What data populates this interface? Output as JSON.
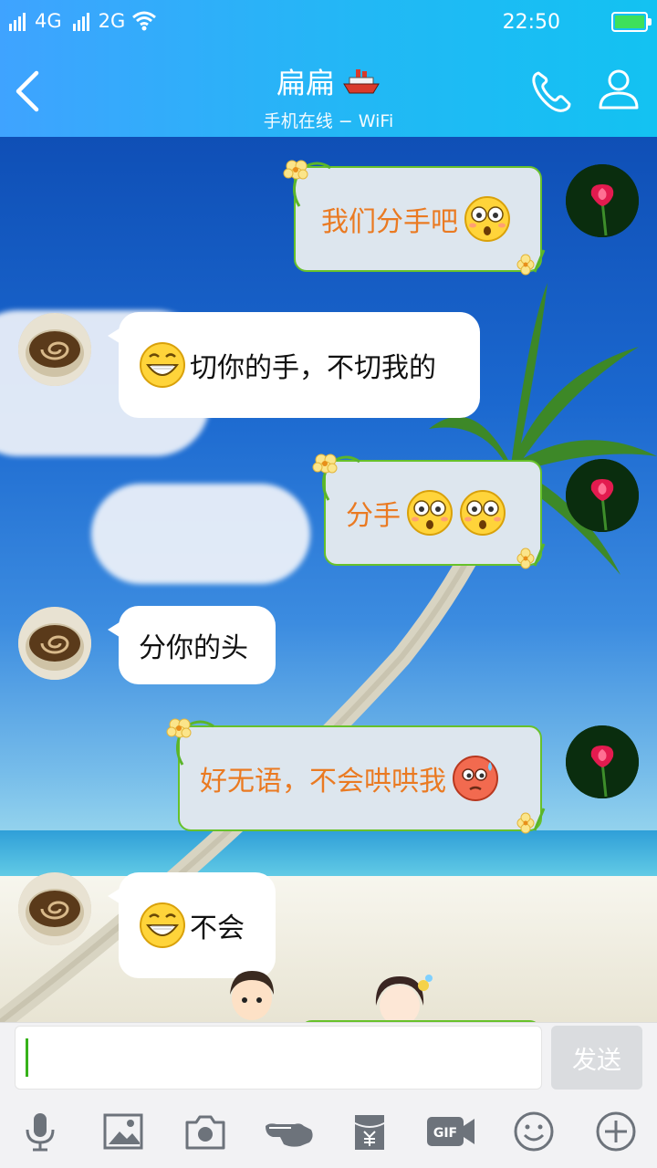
{
  "status_bar": {
    "network1": "4G",
    "sim_index": "2",
    "network2": "2G",
    "time": "22:50",
    "battery_color": "#3ee05a"
  },
  "header": {
    "title": "扁扁",
    "title_emoji": "ship-emoji",
    "subtitle": "手机在线 − WiFi",
    "back_icon": "chevron-left-icon",
    "call_icon": "phone-icon",
    "profile_icon": "person-icon"
  },
  "messages": [
    {
      "side": "sent",
      "text": "我们分手吧",
      "emojis": [
        "shocked-face"
      ]
    },
    {
      "side": "received",
      "text": "切你的手，不切我的",
      "emojis": [
        "grin-face"
      ]
    },
    {
      "side": "sent",
      "text": "分手",
      "emojis": [
        "shocked-face",
        "shocked-face"
      ]
    },
    {
      "side": "received",
      "text": "分你的头",
      "emojis": []
    },
    {
      "side": "sent",
      "text": "好无语，不会哄哄我",
      "emojis": [
        "embarrassed-face"
      ]
    },
    {
      "side": "received",
      "text": "不会",
      "emojis": [
        "grin-face"
      ]
    }
  ],
  "input": {
    "value": "",
    "send_label": "发送"
  },
  "toolbar": [
    "mic-icon",
    "image-icon",
    "camera-icon",
    "poke-icon",
    "red-packet-icon",
    "gif-icon",
    "emoji-icon",
    "plus-icon"
  ],
  "colors": {
    "header_gradient_start": "#3fa3ff",
    "header_gradient_end": "#13c2f2",
    "sent_bubble_text": "#ea7a22",
    "sent_bubble_border": "#67c12a",
    "sent_bubble_bg": "#dde6ee",
    "received_bubble_bg": "#ffffff"
  }
}
